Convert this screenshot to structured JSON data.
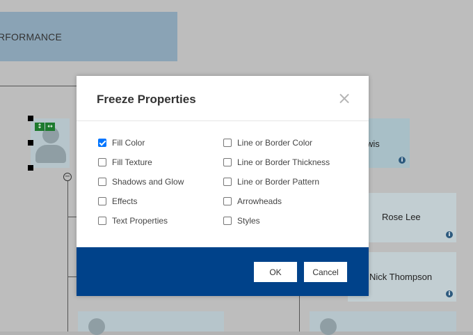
{
  "background": {
    "banner_text": "RFORMANCE",
    "cards": [
      {
        "name": "wis"
      },
      {
        "name": "Rose Lee"
      },
      {
        "name": "Nick Thompson"
      }
    ],
    "info_glyph": "i",
    "collapse_glyph": "−",
    "green_buttons": [
      "↕",
      "↔"
    ]
  },
  "dialog": {
    "title": "Freeze Properties",
    "close_glyph": "×",
    "options_left": [
      {
        "label": "Fill Color",
        "checked": true
      },
      {
        "label": "Fill Texture",
        "checked": false
      },
      {
        "label": "Shadows and Glow",
        "checked": false
      },
      {
        "label": "Effects",
        "checked": false
      },
      {
        "label": "Text Properties",
        "checked": false
      }
    ],
    "options_right": [
      {
        "label": "Line or Border Color",
        "checked": false
      },
      {
        "label": "Line or Border Thickness",
        "checked": false
      },
      {
        "label": "Line or Border Pattern",
        "checked": false
      },
      {
        "label": "Arrowheads",
        "checked": false
      },
      {
        "label": "Styles",
        "checked": false
      }
    ],
    "ok_label": "OK",
    "cancel_label": "Cancel",
    "colors": {
      "footer": "#00428a",
      "checkbox_accent": "#0075ff"
    }
  }
}
